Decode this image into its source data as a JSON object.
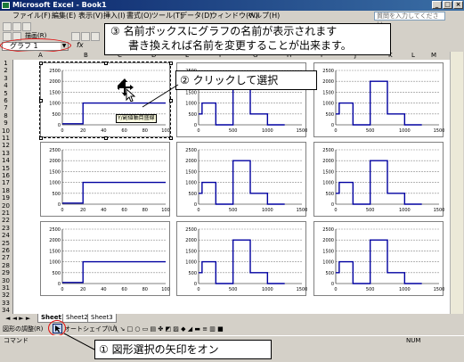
{
  "window": {
    "title": "Microsoft Excel - Book1"
  },
  "menu": [
    "ファイル(F)",
    "編集(E)",
    "表示(V)",
    "挿入(I)",
    "書式(O)",
    "ツール(T)",
    "データ(D)",
    "ウィンドウ(W)",
    "ヘルプ(H)"
  ],
  "help_placeholder": "質問を入力してください",
  "toolbar": {
    "draw_label": "描画(R)"
  },
  "namebox": {
    "value": "グラフ 1"
  },
  "formula": {
    "fx": "fx"
  },
  "columns": [
    "A",
    "B",
    "C",
    "D",
    "E",
    "F",
    "G",
    "H",
    "I",
    "J",
    "K",
    "L",
    "M"
  ],
  "rows": [
    "1",
    "2",
    "3",
    "4",
    "5",
    "6",
    "7",
    "8",
    "9",
    "10",
    "11",
    "12",
    "13",
    "14",
    "15",
    "16",
    "17",
    "18",
    "19",
    "20",
    "21",
    "22",
    "23",
    "24",
    "25",
    "26",
    "27",
    "28",
    "29",
    "30",
    "31",
    "32",
    "33",
    "34"
  ],
  "sheet_tabs": [
    "Sheet1",
    "Sheet2",
    "Sheet3"
  ],
  "drawing_toolbar": {
    "adjust": "図形の調整(R)",
    "autoshape": "オートシェイプ(U)"
  },
  "statusbar": {
    "left": "コマンド",
    "right": "NUM"
  },
  "callouts": {
    "c3_line1": "③ 名前ボックスにグラフの名前が表示されます",
    "c3_line2": "書き換えれば名前を変更することが出来ます。",
    "c2": "② クリックして選択",
    "c1": "① 図形選択の矢印をオン"
  },
  "tooltip": "Y/副値軸目盛線",
  "colors": {
    "series": "#0000a0",
    "callout_oval": "#e01010"
  },
  "chart_data": [
    {
      "type": "line",
      "x": [
        0,
        20,
        20,
        100
      ],
      "values": [
        50,
        50,
        1000,
        1000
      ],
      "xlim": [
        0,
        100
      ],
      "ylim": [
        0,
        2500
      ],
      "yticks": [
        0,
        500,
        1000,
        1500,
        2000,
        2500
      ],
      "xticks": [
        0,
        20,
        40,
        60,
        80,
        100
      ]
    },
    {
      "type": "line",
      "x": [
        0,
        50,
        50,
        250,
        250,
        500,
        500,
        750,
        750,
        1000,
        1000,
        1250
      ],
      "values": [
        500,
        500,
        1000,
        1000,
        0,
        0,
        2000,
        2000,
        500,
        500,
        0,
        0
      ],
      "xlim": [
        0,
        1500
      ],
      "ylim": [
        0,
        2500
      ],
      "yticks": [
        0,
        500,
        1000,
        1500,
        2000,
        2500
      ],
      "xticks": [
        0,
        500,
        1000,
        1500
      ]
    },
    {
      "type": "line",
      "x": [
        0,
        50,
        50,
        250,
        250,
        500,
        500,
        750,
        750,
        1000,
        1000,
        1250
      ],
      "values": [
        500,
        500,
        1000,
        1000,
        0,
        0,
        2000,
        2000,
        500,
        500,
        0,
        0
      ],
      "xlim": [
        0,
        1500
      ],
      "ylim": [
        0,
        2500
      ],
      "yticks": [
        0,
        500,
        1000,
        1500,
        2000,
        2500
      ],
      "xticks": [
        0,
        500,
        1000,
        1500
      ]
    },
    {
      "type": "line",
      "x": [
        0,
        20,
        20,
        100
      ],
      "values": [
        50,
        50,
        1000,
        1000
      ],
      "xlim": [
        0,
        100
      ],
      "ylim": [
        0,
        2500
      ],
      "yticks": [
        0,
        500,
        1000,
        1500,
        2000,
        2500
      ],
      "xticks": [
        0,
        20,
        40,
        60,
        80,
        100
      ]
    },
    {
      "type": "line",
      "x": [
        0,
        50,
        50,
        250,
        250,
        500,
        500,
        750,
        750,
        1000,
        1000,
        1250
      ],
      "values": [
        500,
        500,
        1000,
        1000,
        0,
        0,
        2000,
        2000,
        500,
        500,
        0,
        0
      ],
      "xlim": [
        0,
        1500
      ],
      "ylim": [
        0,
        2500
      ],
      "yticks": [
        0,
        500,
        1000,
        1500,
        2000,
        2500
      ],
      "xticks": [
        0,
        500,
        1000,
        1500
      ]
    },
    {
      "type": "line",
      "x": [
        0,
        50,
        50,
        250,
        250,
        500,
        500,
        750,
        750,
        1000,
        1000,
        1250
      ],
      "values": [
        500,
        500,
        1000,
        1000,
        0,
        0,
        2000,
        2000,
        500,
        500,
        0,
        0
      ],
      "xlim": [
        0,
        1500
      ],
      "ylim": [
        0,
        2500
      ],
      "yticks": [
        0,
        500,
        1000,
        1500,
        2000,
        2500
      ],
      "xticks": [
        0,
        500,
        1000,
        1500
      ]
    },
    {
      "type": "line",
      "x": [
        0,
        20,
        20,
        100
      ],
      "values": [
        50,
        50,
        1000,
        1000
      ],
      "xlim": [
        0,
        100
      ],
      "ylim": [
        0,
        2500
      ],
      "yticks": [
        0,
        500,
        1000,
        1500,
        2000,
        2500
      ],
      "xticks": [
        0,
        20,
        40,
        60,
        80,
        100
      ]
    },
    {
      "type": "line",
      "x": [
        0,
        50,
        50,
        250,
        250,
        500,
        500,
        750,
        750,
        1000,
        1000,
        1250
      ],
      "values": [
        500,
        500,
        1000,
        1000,
        0,
        0,
        2000,
        2000,
        500,
        500,
        0,
        0
      ],
      "xlim": [
        0,
        1500
      ],
      "ylim": [
        0,
        2500
      ],
      "yticks": [
        0,
        500,
        1000,
        1500,
        2000,
        2500
      ],
      "xticks": [
        0,
        500,
        1000,
        1500
      ]
    },
    {
      "type": "line",
      "x": [
        0,
        50,
        50,
        250,
        250,
        500,
        500,
        750,
        750,
        1000,
        1000,
        1250
      ],
      "values": [
        500,
        500,
        1000,
        1000,
        0,
        0,
        2000,
        2000,
        500,
        500,
        0,
        0
      ],
      "xlim": [
        0,
        1500
      ],
      "ylim": [
        0,
        2500
      ],
      "yticks": [
        0,
        500,
        1000,
        1500,
        2000,
        2500
      ],
      "xticks": [
        0,
        500,
        1000,
        1500
      ]
    }
  ]
}
